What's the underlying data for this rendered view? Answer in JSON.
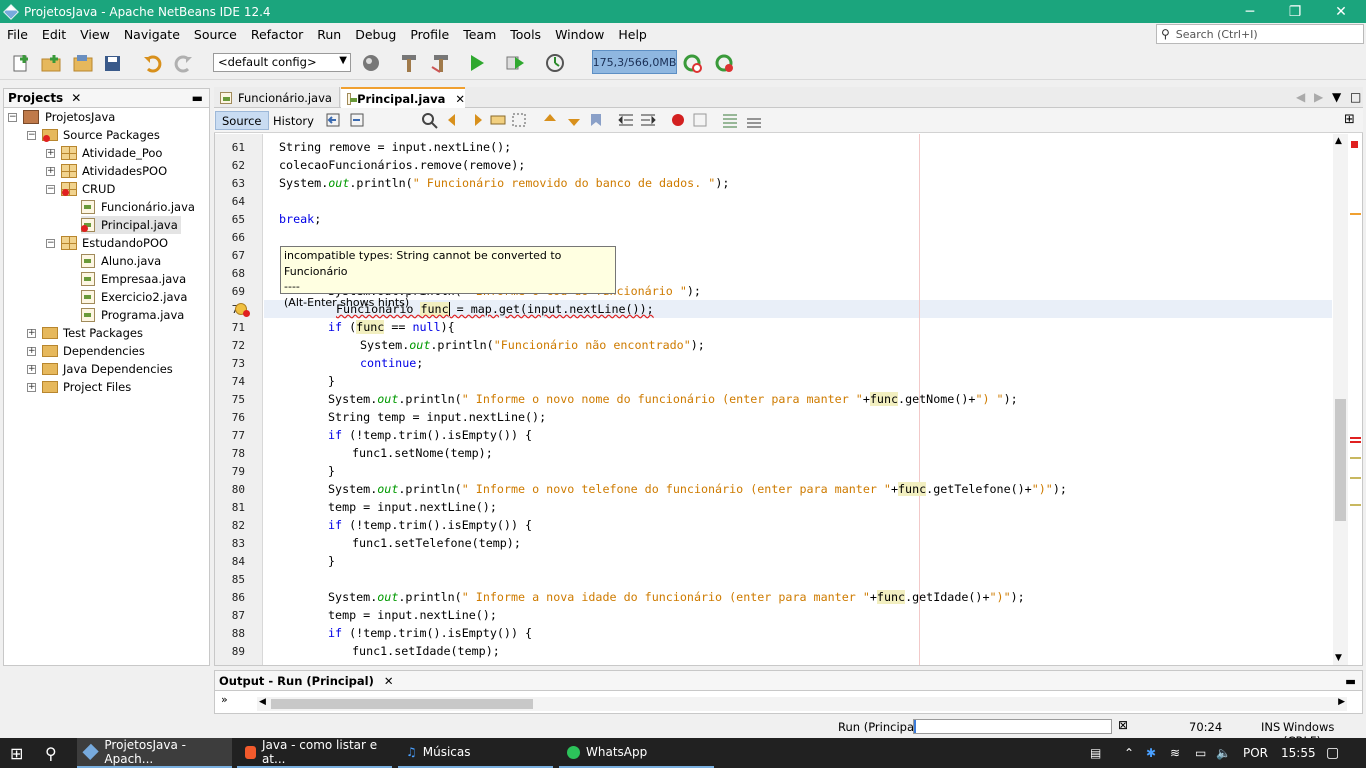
{
  "title_bar": {
    "title": "ProjetosJava - Apache NetBeans IDE 12.4",
    "minimize": "─",
    "restore": "❐",
    "close": "✕"
  },
  "menu": [
    "File",
    "Edit",
    "View",
    "Navigate",
    "Source",
    "Refactor",
    "Run",
    "Debug",
    "Profile",
    "Team",
    "Tools",
    "Window",
    "Help"
  ],
  "search": {
    "placeholder": "Search (Ctrl+I)"
  },
  "toolbar": {
    "config": "<default config>",
    "memory": "175,3/566,0MB"
  },
  "projects": {
    "tab_label": "Projects",
    "root": "ProjetosJava",
    "source_packages": "Source Packages",
    "pkg1": "Atividade_Poo",
    "pkg2": "AtividadesPOO",
    "pkg3": "CRUD",
    "file1": "Funcionário.java",
    "file2": "Principal.java",
    "pkg4": "EstudandoPOO",
    "file3": "Aluno.java",
    "file4": "Empresaa.java",
    "file5": "Exercicio2.java",
    "file6": "Programa.java",
    "test_packages": "Test Packages",
    "dependencies": "Dependencies",
    "java_dependencies": "Java Dependencies",
    "project_files": "Project Files"
  },
  "editor_tabs": [
    {
      "label": "Funcionário.java"
    },
    {
      "label": "Principal.java"
    }
  ],
  "source_bar": {
    "source": "Source",
    "history": "History"
  },
  "line_numbers": [
    "61",
    "62",
    "63",
    "64",
    "65",
    "66",
    "67",
    "68",
    "69",
    "70",
    "71",
    "72",
    "73",
    "74",
    "75",
    "76",
    "77",
    "78",
    "79",
    "80",
    "81",
    "82",
    "83",
    "84",
    "85",
    "86",
    "87",
    "88",
    "89"
  ],
  "code": {
    "l61": "String remove = input.nextLine();",
    "l62": "colecaoFuncionários.remove(remove);",
    "l63a": "System.",
    "l63b": "out",
    "l63c": ".println(",
    "l63d": "\" Funcionário removido do banco de dados. \"",
    "l63e": ");",
    "l65": "break",
    "l69a": "System.out.println(",
    "l69b": "\" Informe o cod do funcionário \"",
    "l69c": ");",
    "l70a": "Funcionário ",
    "l70b": "func",
    "l70c": " = map.get(input.nextLine());",
    "l71a": "if",
    "l71b": " (",
    "l71c": "func",
    "l71d": " == ",
    "l71e": "null",
    "l71f": "){",
    "l72a": "System.",
    "l72b": "out",
    "l72c": ".println(",
    "l72d": "\"Funcionário não encontrado\"",
    "l72e": ");",
    "l73": "continue",
    "l74": "}",
    "l75a": "System.",
    "l75b": "out",
    "l75c": ".println(",
    "l75d": "\" Informe o novo nome do funcionário (enter para manter \"",
    "l75e": "+",
    "l75f": "func",
    "l75g": ".getNome()+",
    "l75h": "\") \"",
    "l75i": ");",
    "l76": "String temp = input.nextLine();",
    "l77a": "if",
    "l77b": " (!temp.trim().isEmpty()) {",
    "l78": "func1.setNome(temp);",
    "l79": "}",
    "l80a": "System.",
    "l80b": "out",
    "l80c": ".println(",
    "l80d": "\" Informe o novo telefone do funcionário (enter para manter \"",
    "l80e": "+",
    "l80f": "func",
    "l80g": ".getTelefone()+",
    "l80h": "\")\"",
    "l80i": ");",
    "l81": "temp = input.nextLine();",
    "l82a": "if",
    "l82b": " (!temp.trim().isEmpty()) {",
    "l83": "func1.setTelefone(temp);",
    "l84": "}",
    "l86a": "System.",
    "l86b": "out",
    "l86c": ".println(",
    "l86d": "\" Informe a nova idade do funcionário (enter para manter \"",
    "l86e": "+",
    "l86f": "func",
    "l86g": ".getIdade()+",
    "l86h": "\")\"",
    "l86i": ");",
    "l87": "temp = input.nextLine();",
    "l88a": "if",
    "l88b": " (!temp.trim().isEmpty()) {",
    "l89": "func1.setIdade(temp);"
  },
  "tooltip": {
    "line1": "incompatible types: String cannot be converted to Funcionário",
    "line2": "----",
    "line3": "(Alt-Enter shows hints)"
  },
  "output": {
    "tab_label": "Output - Run (Principal)"
  },
  "status": {
    "run": "Run (Principal)",
    "position": "70:24",
    "mode": "INS",
    "line_ending": "Windows (CRLF)"
  },
  "taskbar": {
    "item1": "ProjetosJava - Apach...",
    "item2": "Java - como listar e at...",
    "item3": "Músicas",
    "item4": "WhatsApp",
    "lang": "POR",
    "time": "15:55"
  },
  "colors": {
    "title_bar": "#1ba57d",
    "string": "#ce7b00",
    "keyword": "#0000e6",
    "field": "#009900",
    "error": "#e02020"
  }
}
